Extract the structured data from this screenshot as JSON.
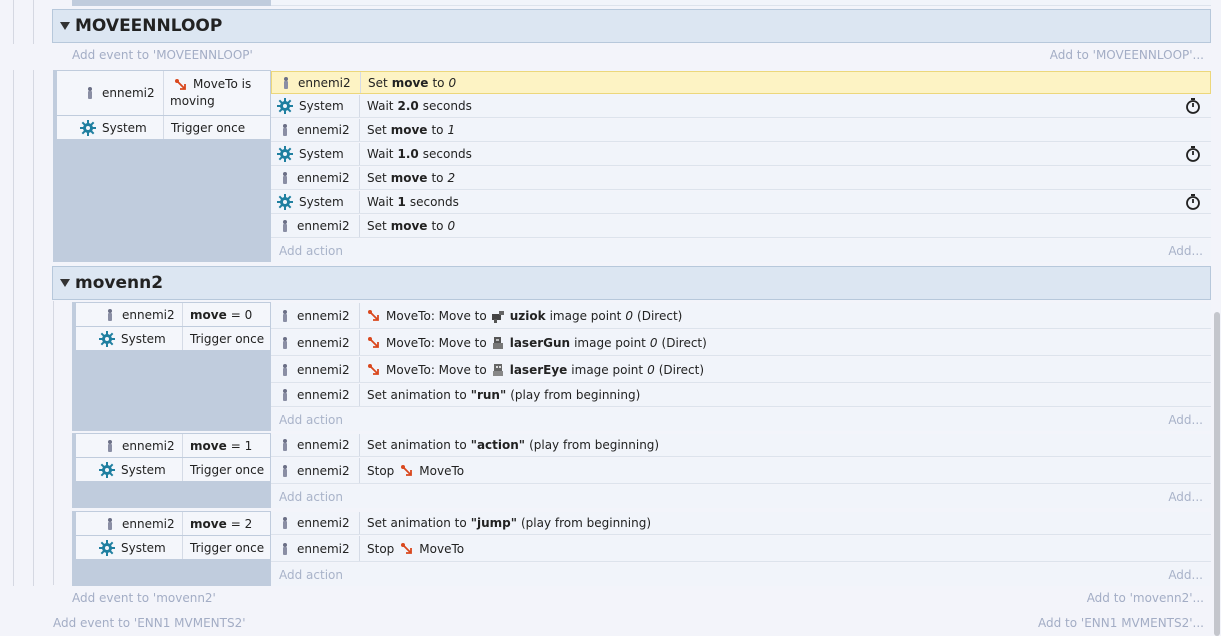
{
  "groups": [
    {
      "name": "MOVEENNLOOP",
      "add_event": "Add event to 'MOVEENNLOOP'",
      "add_to": "Add to 'MOVEENNLOOP'...",
      "events": [
        {
          "conditions": [
            {
              "object": "ennemi2",
              "text": "MoveTo is moving"
            },
            {
              "object": "System",
              "text": "Trigger once"
            }
          ],
          "actions": [
            {
              "object": "ennemi2",
              "pre": "Set",
              "bold": "move",
              "mid": "to",
              "ital": "0"
            },
            {
              "object": "System",
              "pre": "Wait",
              "bold": "2.0",
              "mid": "seconds"
            },
            {
              "object": "ennemi2",
              "pre": "Set",
              "bold": "move",
              "mid": "to",
              "ital": "1"
            },
            {
              "object": "System",
              "pre": "Wait",
              "bold": "1.0",
              "mid": "seconds"
            },
            {
              "object": "ennemi2",
              "pre": "Set",
              "bold": "move",
              "mid": "to",
              "ital": "2"
            },
            {
              "object": "System",
              "pre": "Wait",
              "bold": "1",
              "mid": "seconds"
            },
            {
              "object": "ennemi2",
              "pre": "Set",
              "bold": "move",
              "mid": "to",
              "ital": "0"
            }
          ],
          "add_action": "Add action",
          "add_more": "Add..."
        }
      ]
    },
    {
      "name": "movenn2",
      "add_event": "Add event to 'movenn2'",
      "add_to": "Add to 'movenn2'...",
      "events": [
        {
          "conditions": [
            {
              "object": "ennemi2",
              "bold": "move",
              "text": "= 0"
            },
            {
              "object": "System",
              "text": "Trigger once"
            }
          ],
          "actions": [
            {
              "object": "ennemi2",
              "pre": "MoveTo: Move to",
              "bold": "uziok",
              "post": "image point",
              "ital": "0",
              "tail": "(Direct)"
            },
            {
              "object": "ennemi2",
              "pre": "MoveTo: Move to",
              "bold": "laserGun",
              "post": "image point",
              "ital": "0",
              "tail": "(Direct)"
            },
            {
              "object": "ennemi2",
              "pre": "MoveTo: Move to",
              "bold": "laserEye",
              "post": "image point",
              "ital": "0",
              "tail": "(Direct)"
            },
            {
              "object": "ennemi2",
              "pre": "Set animation to",
              "bold": "\"run\"",
              "tail": "(play from beginning)"
            }
          ],
          "add_action": "Add action",
          "add_more": "Add..."
        },
        {
          "conditions": [
            {
              "object": "ennemi2",
              "bold": "move",
              "text": "= 1"
            },
            {
              "object": "System",
              "text": "Trigger once"
            }
          ],
          "actions": [
            {
              "object": "ennemi2",
              "pre": "Set animation to",
              "bold": "\"action\"",
              "tail": "(play from beginning)"
            },
            {
              "object": "ennemi2",
              "pre": "Stop",
              "behavior": "MoveTo"
            }
          ],
          "add_action": "Add action",
          "add_more": "Add..."
        },
        {
          "conditions": [
            {
              "object": "ennemi2",
              "bold": "move",
              "text": "= 2"
            },
            {
              "object": "System",
              "text": "Trigger once"
            }
          ],
          "actions": [
            {
              "object": "ennemi2",
              "pre": "Set animation to",
              "bold": "\"jump\"",
              "tail": "(play from beginning)"
            },
            {
              "object": "ennemi2",
              "pre": "Stop",
              "behavior": "MoveTo"
            }
          ],
          "add_action": "Add action",
          "add_more": "Add..."
        }
      ]
    }
  ],
  "footer": {
    "add_event": "Add event to 'ENN1 MVMENTS2'",
    "add_to": "Add to 'ENN1 MVMENTS2'..."
  },
  "colors": {
    "gear": "#1f7fa0",
    "moveto_arrow": "#d9481e",
    "highlight": "#fdf3c4"
  }
}
